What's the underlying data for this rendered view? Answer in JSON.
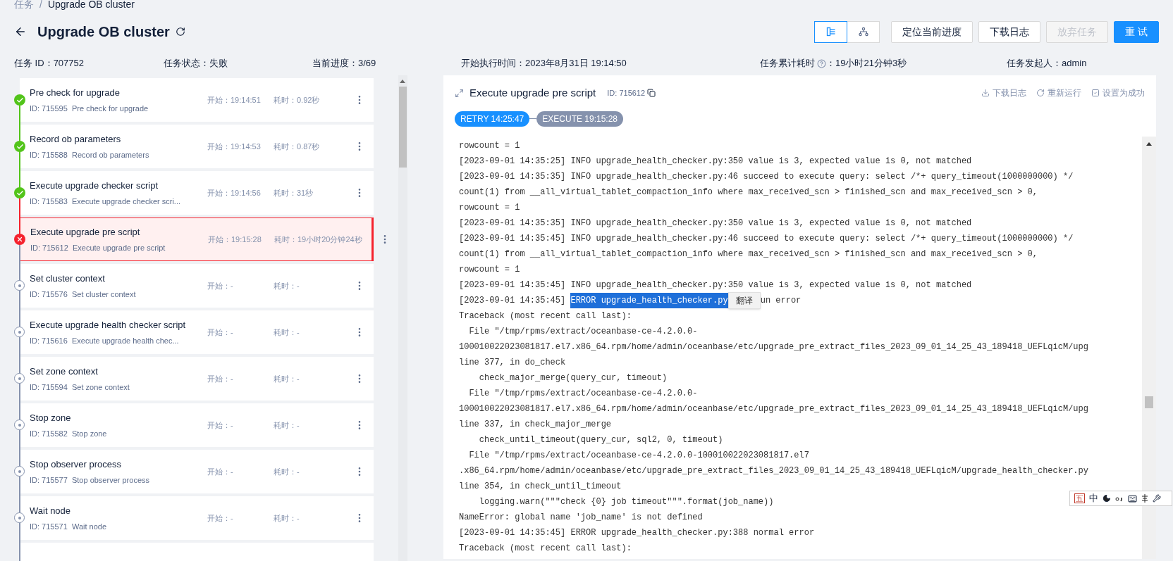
{
  "breadcrumb": [
    "任务",
    "/",
    "Upgrade OB cluster"
  ],
  "title": "Upgrade OB cluster",
  "view_toggle": [
    {
      "kind": "list",
      "selected": true
    },
    {
      "kind": "tree",
      "selected": false
    }
  ],
  "actions": [
    {
      "label": "定位当前进度",
      "kind": "default",
      "disabled": false
    },
    {
      "label": "下载日志",
      "kind": "default",
      "disabled": false
    },
    {
      "label": "放弃任务",
      "kind": "default",
      "disabled": true
    },
    {
      "label": "重 试",
      "kind": "primary",
      "disabled": false
    }
  ],
  "info": [
    {
      "label": "任务 ID：",
      "value": "707752"
    },
    {
      "label": "任务状态：",
      "value": "失败"
    },
    {
      "label": "当前进度：",
      "value": "3/69"
    },
    {
      "label": "开始执行时间：",
      "value": "2023年8月31日 19:14:50"
    },
    {
      "label": "任务累计耗时",
      "help": true,
      "value": "：19小时21分钟3秒"
    },
    {
      "label": "任务发起人：",
      "value": "admin"
    }
  ],
  "tasks": [
    {
      "name": "Pre check for upgrade",
      "id": "ID: 715595",
      "desc": "Pre check for upgrade",
      "start": "开始：19:14:51",
      "duration": "耗时：0.92秒",
      "kind": "success",
      "selected": false
    },
    {
      "name": "Record ob parameters",
      "id": "ID: 715588",
      "desc": "Record ob parameters",
      "start": "开始：19:14:53",
      "duration": "耗时：0.87秒",
      "kind": "success",
      "selected": false
    },
    {
      "name": "Execute upgrade checker script",
      "id": "ID: 715583",
      "desc": "Execute upgrade checker scri...",
      "start": "开始：19:14:56",
      "duration": "耗时：31秒",
      "kind": "success",
      "selected": false
    },
    {
      "name": "Execute upgrade pre script",
      "id": "ID: 715612",
      "desc": "Execute upgrade pre script",
      "start": "开始：19:15:28",
      "duration": "耗时：19小时20分钟24秒",
      "kind": "failed",
      "selected": true
    },
    {
      "name": "Set cluster context",
      "id": "ID: 715576",
      "desc": "Set cluster context",
      "start": "开始：-",
      "duration": "耗时：-",
      "kind": "pending",
      "selected": false
    },
    {
      "name": "Execute upgrade health checker script",
      "id": "ID: 715616",
      "desc": "Execute upgrade health chec...",
      "start": "开始：-",
      "duration": "耗时：-",
      "kind": "pending",
      "selected": false
    },
    {
      "name": "Set zone context",
      "id": "ID: 715594",
      "desc": "Set zone context",
      "start": "开始：-",
      "duration": "耗时：-",
      "kind": "pending",
      "selected": false
    },
    {
      "name": "Stop zone",
      "id": "ID: 715582",
      "desc": "Stop zone",
      "start": "开始：-",
      "duration": "耗时：-",
      "kind": "pending",
      "selected": false
    },
    {
      "name": "Stop observer process",
      "id": "ID: 715577",
      "desc": "Stop observer process",
      "start": "开始：-",
      "duration": "耗时：-",
      "kind": "pending",
      "selected": false
    },
    {
      "name": "Wait node",
      "id": "ID: 715571",
      "desc": "Wait node",
      "start": "开始：-",
      "duration": "耗时：-",
      "kind": "pending",
      "selected": false
    }
  ],
  "detail": {
    "title": "Execute upgrade pre script",
    "id": "ID: 715612",
    "actions": [
      {
        "kind": "download",
        "label": "下载日志"
      },
      {
        "kind": "rerun",
        "label": "重新运行"
      },
      {
        "kind": "success",
        "label": "设置为成功"
      }
    ],
    "runs": [
      {
        "label": "RETRY 14:25:47",
        "selected": true
      },
      {
        "label": "EXECUTE 19:15:28",
        "selected": false
      }
    ]
  },
  "log": [
    {
      "kind": "text",
      "text": "rowcount = 1"
    },
    {
      "kind": "text",
      "text": "[2023-09-01 14:35:25] INFO upgrade_health_checker.py:350 value is 3, expected value is 0, not matched"
    },
    {
      "kind": "text",
      "text": "[2023-09-01 14:35:35] INFO upgrade_health_checker.py:46 succeed to execute query: select /*+ query_timeout(1000000000) */"
    },
    {
      "kind": "text",
      "text": "count(1) from __all_virtual_tablet_compaction_info where max_received_scn > finished_scn and max_received_scn > 0,"
    },
    {
      "kind": "text",
      "text": "rowcount = 1"
    },
    {
      "kind": "text",
      "text": "[2023-09-01 14:35:35] INFO upgrade_health_checker.py:350 value is 3, expected value is 0, not matched"
    },
    {
      "kind": "text",
      "text": "[2023-09-01 14:35:45] INFO upgrade_health_checker.py:46 succeed to execute query: select /*+ query_timeout(1000000000) */"
    },
    {
      "kind": "text",
      "text": "count(1) from __all_virtual_tablet_compaction_info where max_received_scn > finished_scn and max_received_scn > 0,"
    },
    {
      "kind": "text",
      "text": "rowcount = 1"
    },
    {
      "kind": "text",
      "text": "[2023-09-01 14:35:45] INFO upgrade_health_checker.py:350 value is 3, expected value is 0, not matched"
    },
    {
      "kind": "selection",
      "prefix": "[2023-09-01 14:35:45] ",
      "selected": "ERROR upgrade_health_checker.py",
      "popup": "翻译",
      "suffix": "un error"
    },
    {
      "kind": "text",
      "text": "Traceback (most recent call last):"
    },
    {
      "kind": "text",
      "text": "  File \"/tmp/rpms/extract/oceanbase-ce-4.2.0.0-"
    },
    {
      "kind": "text",
      "text": "100010022023081817.el7.x86_64.rpm/home/admin/oceanbase/etc/upgrade_pre_extract_files_2023_09_01_14_25_43_189418_UEFLqicM/upg"
    },
    {
      "kind": "text",
      "text": "line 377, in do_check"
    },
    {
      "kind": "text",
      "text": "    check_major_merge(query_cur, timeout)"
    },
    {
      "kind": "text",
      "text": "  File \"/tmp/rpms/extract/oceanbase-ce-4.2.0.0-"
    },
    {
      "kind": "text",
      "text": "100010022023081817.el7.x86_64.rpm/home/admin/oceanbase/etc/upgrade_pre_extract_files_2023_09_01_14_25_43_189418_UEFLqicM/upg"
    },
    {
      "kind": "text",
      "text": "line 337, in check_major_merge"
    },
    {
      "kind": "text",
      "text": "    check_until_timeout(query_cur, sql2, 0, timeout)"
    },
    {
      "kind": "text",
      "text": "  File \"/tmp/rpms/extract/oceanbase-ce-4.2.0.0-100010022023081817.el7"
    },
    {
      "kind": "text",
      "text": ".x86_64.rpm/home/admin/oceanbase/etc/upgrade_pre_extract_files_2023_09_01_14_25_43_189418_UEFLqicM/upgrade_health_checker.py"
    },
    {
      "kind": "text",
      "text": "line 354, in check_until_timeout"
    },
    {
      "kind": "text",
      "text": "    logging.warn(\"\"\"check {0} job timeout\"\"\".format(job_name))"
    },
    {
      "kind": "text",
      "text": "NameError: global name 'job_name' is not defined"
    },
    {
      "kind": "text",
      "text": "[2023-09-01 14:35:45] ERROR upgrade_health_checker.py:388 normal error"
    },
    {
      "kind": "text",
      "text": "Traceback (most recent call last):"
    }
  ],
  "ime_bar": {
    "mode": "五",
    "language": "中"
  }
}
